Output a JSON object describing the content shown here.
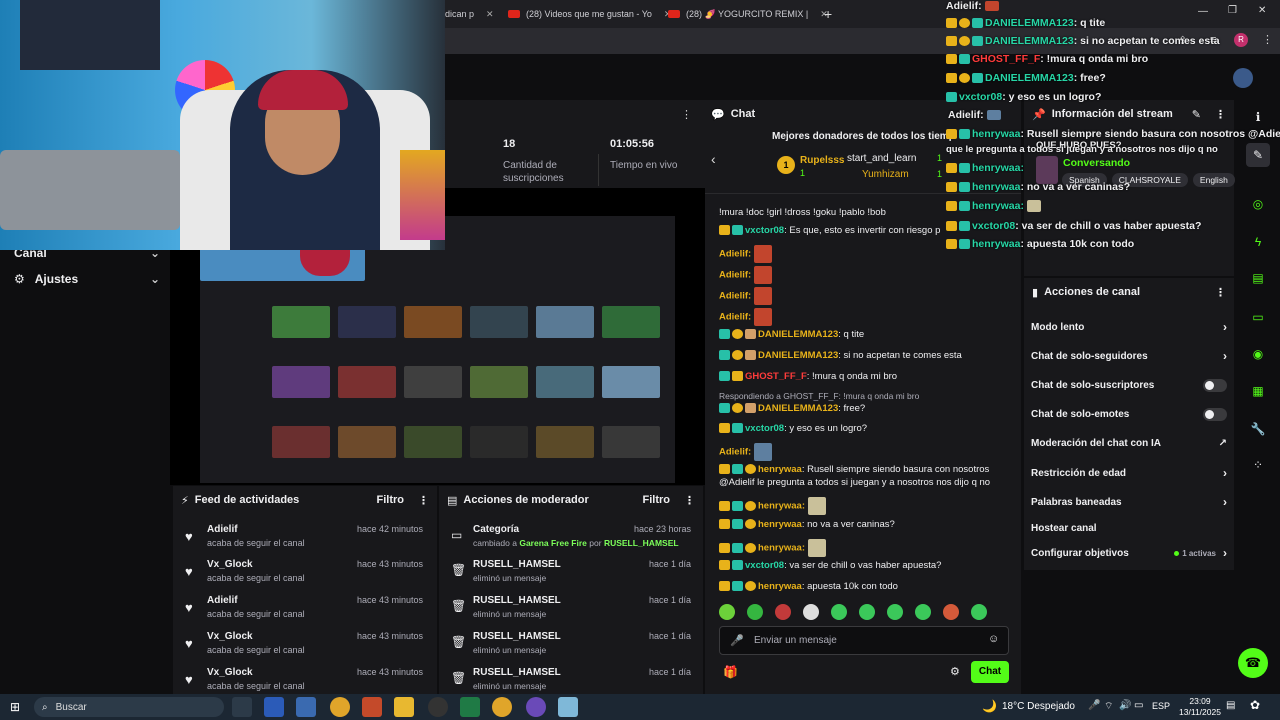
{
  "browser": {
    "tabs": [
      {
        "label": "indican p"
      },
      {
        "label": "(28) Videos que me gustan - Yo"
      },
      {
        "label": "(28) 🍠 YOGURCITO REMIX |"
      }
    ],
    "new_tab": "+",
    "avatar_letter": "R"
  },
  "sidebar": {
    "items": [
      {
        "label": "Canal"
      },
      {
        "label": "Ajustes"
      }
    ]
  },
  "stats": {
    "subs_value": "18",
    "subs_label": "Cantidad de suscripciones",
    "live_value": "01:05:56",
    "live_label": "Tiempo en vivo"
  },
  "activity_feed": {
    "title": "Feed de actividades",
    "filter": "Filtro",
    "items": [
      {
        "name": "Adielif",
        "sub": "acaba de seguir el canal",
        "time": "hace 42 minutos"
      },
      {
        "name": "Vx_Glock",
        "sub": "acaba de seguir el canal",
        "time": "hace 43 minutos"
      },
      {
        "name": "Adielif",
        "sub": "acaba de seguir el canal",
        "time": "hace 43 minutos"
      },
      {
        "name": "Vx_Glock",
        "sub": "acaba de seguir el canal",
        "time": "hace 43 minutos"
      },
      {
        "name": "Vx_Glock",
        "sub": "acaba de seguir el canal",
        "time": "hace 43 minutos"
      }
    ]
  },
  "mod_actions": {
    "title": "Acciones de moderador",
    "filter": "Filtro",
    "category": {
      "name": "Categoría",
      "time": "hace 23 horas",
      "prefix": "cambiado a",
      "game": "Garena Free Fire",
      "by": "por",
      "user": "RUSELL_HAMSEL"
    },
    "items": [
      {
        "name": "RUSELL_HAMSEL",
        "sub": "eliminó un mensaje",
        "time": "hace 1 día"
      },
      {
        "name": "RUSELL_HAMSEL",
        "sub": "eliminó un mensaje",
        "time": "hace 1 día"
      },
      {
        "name": "RUSELL_HAMSEL",
        "sub": "eliminó un mensaje",
        "time": "hace 1 día"
      },
      {
        "name": "RUSELL_HAMSEL",
        "sub": "eliminó un mensaje",
        "time": "hace 1 día"
      }
    ]
  },
  "chat": {
    "title": "Chat",
    "donors_title": "Mejores donadores de todos los tiemp",
    "donor1": "Rupelsss",
    "donor1_amount": "1",
    "donor2": "start_and_learn",
    "donor2_amount": "1",
    "donor3": "Yumhizam",
    "donor3_amount": "1",
    "top_line": "!mura !doc !girl !dross !goku !pablo !bob",
    "messages": [
      {
        "user": "vxctor08",
        "text": ": Es que, esto es invertir con riesgo p"
      },
      {
        "user": "Adielif:",
        "text": ""
      },
      {
        "user": "Adielif:",
        "text": ""
      },
      {
        "user": "Adielif:",
        "text": ""
      },
      {
        "user": "Adielif:",
        "text": ""
      },
      {
        "user": "DANIELEMMA123",
        "text": ": q tite"
      },
      {
        "user": "DANIELEMMA123",
        "text": ": si no acpetan te comes esta"
      },
      {
        "user": "GHOST_FF_F",
        "text": ": !mura q onda mi bro"
      },
      {
        "user": "DANIELEMMA123",
        "text": ": free?"
      },
      {
        "user": "vxctor08",
        "text": ": y eso es un logro?"
      },
      {
        "user": "Adielif:",
        "text": ""
      },
      {
        "user": "henrywaa",
        "text": ": Rusell siempre siendo basura con nosotros"
      },
      {
        "user": "henrywaa:",
        "text": ""
      },
      {
        "user": "henrywaa",
        "text": ": no va a ver caninas?"
      },
      {
        "user": "henrywaa:",
        "text": ""
      },
      {
        "user": "vxctor08",
        "text": ": va ser de chill o vas haber apuesta?"
      },
      {
        "user": "henrywaa",
        "text": ": apuesta 10k con todo"
      }
    ],
    "reply_note": "Respondiendo a GHOST_FF_F: !mura q onda mi bro",
    "wrap_line": "@Adielif le pregunta a todos si juegan y a nosotros nos dijo q no",
    "input_placeholder": "Enviar un mensaje",
    "send_label": "Chat"
  },
  "overlay_chat": [
    {
      "user": "Adielif:",
      "text": ""
    },
    {
      "user": "DANIELEMMA123",
      "text": ": q tite"
    },
    {
      "user": "DANIELEMMA123",
      "text": ": si no acpetan te comes esta"
    },
    {
      "user": "GHOST_FF_F",
      "text": ": !mura q onda mi bro"
    },
    {
      "user": "DANIELEMMA123",
      "text": ": free?"
    },
    {
      "user": "vxctor08",
      "text": ": y eso es un logro?"
    },
    {
      "user": "Adielif:",
      "text": ""
    },
    {
      "user": "henrywaa",
      "text": ": Rusell siempre siendo basura con nosotros @Adielif le pr"
    },
    {
      "user": "",
      "text": "QUE HUBO PUES?"
    },
    {
      "user": "henrywaa:",
      "text": ""
    },
    {
      "user": "henrywaa",
      "text": ": no va a ver caninas?"
    },
    {
      "user": "henrywaa:",
      "text": ""
    },
    {
      "user": "vxctor08",
      "text": ": va ser de chill o vas haber apuesta?"
    },
    {
      "user": "henrywaa",
      "text": ": apuesta 10k con todo"
    },
    {
      "user": "",
      "text": "que le pregunta a todos si juegan y a nosotros nos dijo q no"
    }
  ],
  "stream_info": {
    "title": "Información del stream",
    "category": "Conversando",
    "tags": [
      "Spanish",
      "CLAHSROYALE",
      "English"
    ]
  },
  "channel_actions": {
    "title": "Acciones de canal",
    "rows": [
      {
        "label": "Modo lento"
      },
      {
        "label": "Chat de solo-seguidores"
      },
      {
        "label": "Chat de solo-suscriptores"
      },
      {
        "label": "Chat de solo-emotes"
      },
      {
        "label": "Moderación del chat con IA"
      },
      {
        "label": "Restricción de edad"
      },
      {
        "label": "Palabras baneadas"
      },
      {
        "label": "Hostear canal"
      },
      {
        "label": "Configurar objetivos"
      }
    ],
    "goals_active": "1 activas"
  },
  "taskbar": {
    "search": "Buscar",
    "weather": "18°C  Despejado",
    "lang": "ESP",
    "time": "23:09",
    "date": "13/11/2025"
  },
  "colors": {
    "accent": "#53fc18",
    "panel": "#18181b",
    "bg": "#0e0e10",
    "user_green": "#27d6a6",
    "ghost_red": "#ff3b3b"
  }
}
